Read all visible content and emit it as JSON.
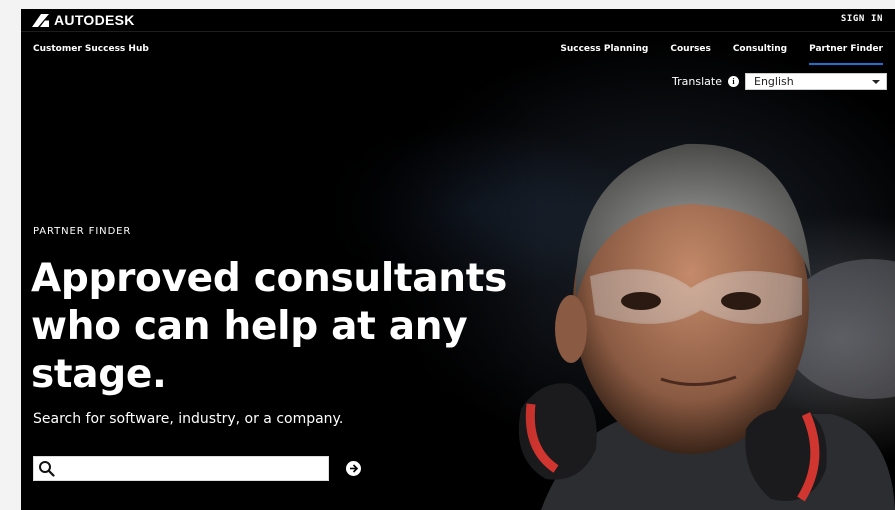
{
  "brand": {
    "logo_text": "AUTODESK"
  },
  "header": {
    "signin_label": "SIGN IN",
    "hub_title": "Customer Success Hub"
  },
  "nav": {
    "items": [
      {
        "label": "Success Planning"
      },
      {
        "label": "Courses"
      },
      {
        "label": "Consulting"
      },
      {
        "label": "Partner Finder",
        "active": true
      }
    ]
  },
  "translate": {
    "label": "Translate",
    "selected_language": "English"
  },
  "hero": {
    "eyebrow": "PARTNER FINDER",
    "headline": "Approved consultants who can help at any stage.",
    "subhead": "Search for software, industry, or a company.",
    "search_placeholder": "",
    "search_value": ""
  },
  "colors": {
    "background": "#000000",
    "active_underline": "#1f6fd1",
    "text": "#ffffff"
  }
}
